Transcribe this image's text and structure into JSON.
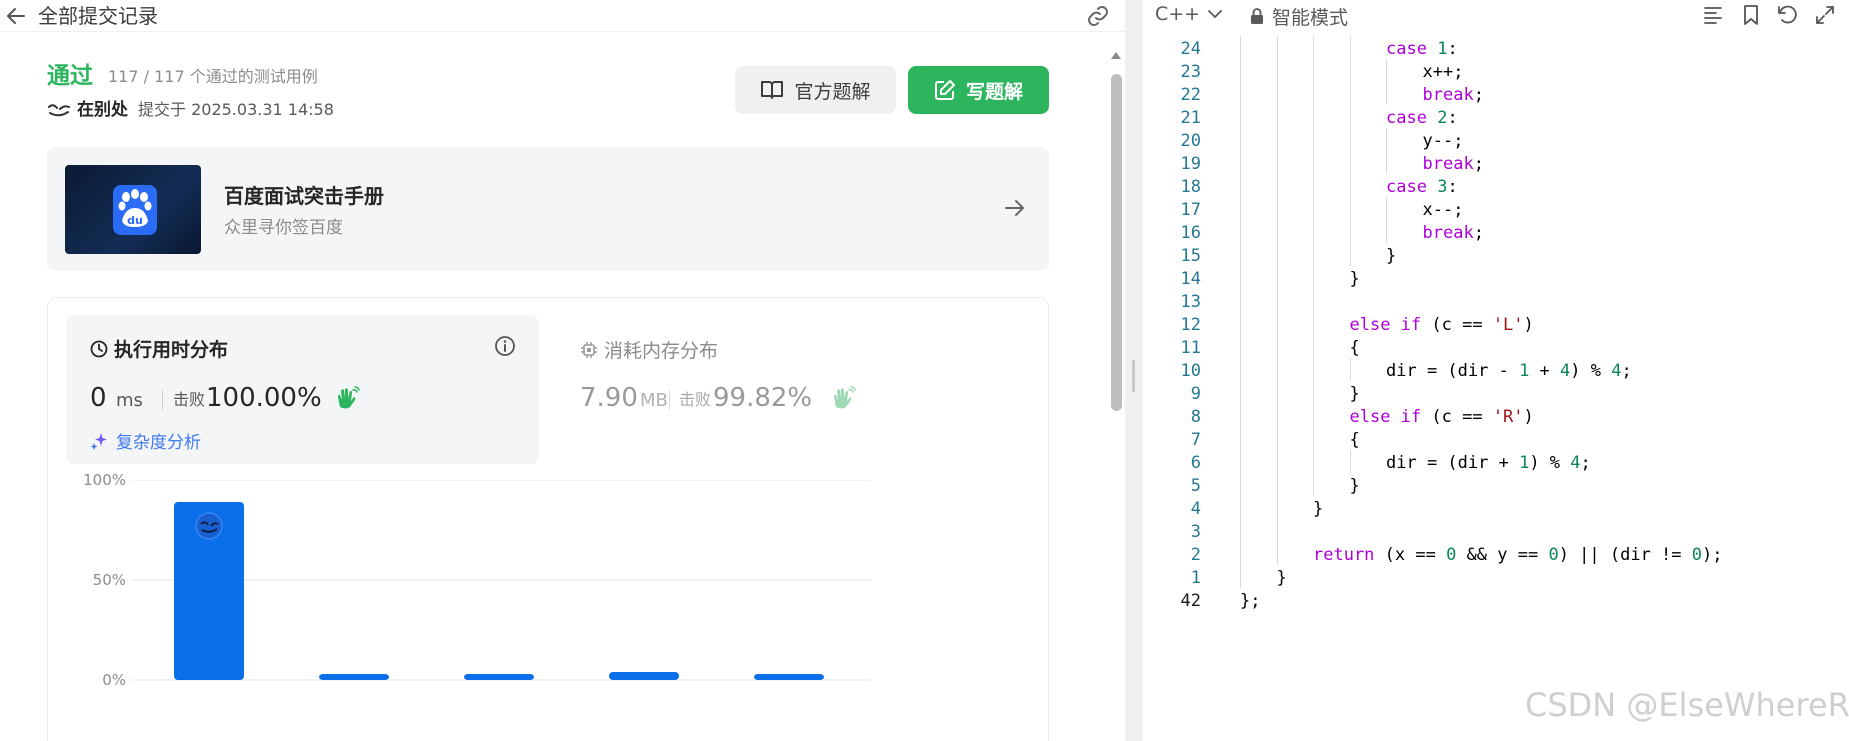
{
  "topbar": {
    "title": "全部提交记录",
    "back_icon": "arrow-left-icon",
    "link_icon": "link-icon"
  },
  "submission": {
    "status": "通过",
    "tests_detail": "117 / 117 个通过的测试用例",
    "author": "在别处",
    "submitted_at": "提交于 2025.03.31 14:58"
  },
  "buttons": {
    "official_solution": "官方题解",
    "write_solution": "写题解"
  },
  "promo": {
    "title": "百度面试突击手册",
    "subtitle": "众里寻你签百度",
    "logo_text": "du"
  },
  "runtime": {
    "title": "执行用时分布",
    "value": "0",
    "unit": "ms",
    "beat_label": "击败",
    "beat_value": "100.00%",
    "complexity_link": "复杂度分析"
  },
  "memory": {
    "title": "消耗内存分布",
    "value": "7.90",
    "unit": "MB",
    "beat_label": "击败",
    "beat_value": "99.82%"
  },
  "chart_data": {
    "type": "bar",
    "title": "",
    "xlabel": "",
    "ylabel": "",
    "y_ticks": [
      "100%",
      "50%",
      "0%"
    ],
    "ylim": [
      0,
      100
    ],
    "grid": true,
    "values": [
      89,
      3,
      3,
      4,
      3
    ],
    "highlight_index": 0,
    "bar_color": "#0a6fe8"
  },
  "editor": {
    "language": "C++",
    "mode": "智能模式",
    "lines": [
      {
        "n": "24",
        "code": [
          {
            "t": "case ",
            "c": "kw"
          },
          {
            "t": "1",
            "c": "num"
          },
          {
            "t": ":",
            "c": ""
          }
        ],
        "indent": 4
      },
      {
        "n": "23",
        "code": [
          {
            "t": "x++;",
            "c": ""
          }
        ],
        "indent": 5
      },
      {
        "n": "22",
        "code": [
          {
            "t": "break",
            "c": "kw"
          },
          {
            "t": ";",
            "c": ""
          }
        ],
        "indent": 5
      },
      {
        "n": "21",
        "code": [
          {
            "t": "case ",
            "c": "kw"
          },
          {
            "t": "2",
            "c": "num"
          },
          {
            "t": ":",
            "c": ""
          }
        ],
        "indent": 4
      },
      {
        "n": "20",
        "code": [
          {
            "t": "y--;",
            "c": ""
          }
        ],
        "indent": 5
      },
      {
        "n": "19",
        "code": [
          {
            "t": "break",
            "c": "kw"
          },
          {
            "t": ";",
            "c": ""
          }
        ],
        "indent": 5
      },
      {
        "n": "18",
        "code": [
          {
            "t": "case ",
            "c": "kw"
          },
          {
            "t": "3",
            "c": "num"
          },
          {
            "t": ":",
            "c": ""
          }
        ],
        "indent": 4
      },
      {
        "n": "17",
        "code": [
          {
            "t": "x--;",
            "c": ""
          }
        ],
        "indent": 5
      },
      {
        "n": "16",
        "code": [
          {
            "t": "break",
            "c": "kw"
          },
          {
            "t": ";",
            "c": ""
          }
        ],
        "indent": 5
      },
      {
        "n": "15",
        "code": [
          {
            "t": "}",
            "c": ""
          }
        ],
        "indent": 4
      },
      {
        "n": "14",
        "code": [
          {
            "t": "}",
            "c": ""
          }
        ],
        "indent": 3
      },
      {
        "n": "13",
        "code": [],
        "indent": 3
      },
      {
        "n": "12",
        "code": [
          {
            "t": "else if ",
            "c": "kw"
          },
          {
            "t": "(c == ",
            "c": ""
          },
          {
            "t": "'L'",
            "c": "str"
          },
          {
            "t": ")",
            "c": ""
          }
        ],
        "indent": 3
      },
      {
        "n": "11",
        "code": [
          {
            "t": "{",
            "c": ""
          }
        ],
        "indent": 3
      },
      {
        "n": "10",
        "code": [
          {
            "t": "dir = (dir - ",
            "c": ""
          },
          {
            "t": "1",
            "c": "num"
          },
          {
            "t": " + ",
            "c": ""
          },
          {
            "t": "4",
            "c": "num"
          },
          {
            "t": ") % ",
            "c": ""
          },
          {
            "t": "4",
            "c": "num"
          },
          {
            "t": ";",
            "c": ""
          }
        ],
        "indent": 4
      },
      {
        "n": "9",
        "code": [
          {
            "t": "}",
            "c": ""
          }
        ],
        "indent": 3
      },
      {
        "n": "8",
        "code": [
          {
            "t": "else if ",
            "c": "kw"
          },
          {
            "t": "(c == ",
            "c": ""
          },
          {
            "t": "'R'",
            "c": "str"
          },
          {
            "t": ")",
            "c": ""
          }
        ],
        "indent": 3
      },
      {
        "n": "7",
        "code": [
          {
            "t": "{",
            "c": ""
          }
        ],
        "indent": 3
      },
      {
        "n": "6",
        "code": [
          {
            "t": "dir = (dir + ",
            "c": ""
          },
          {
            "t": "1",
            "c": "num"
          },
          {
            "t": ") % ",
            "c": ""
          },
          {
            "t": "4",
            "c": "num"
          },
          {
            "t": ";",
            "c": ""
          }
        ],
        "indent": 4
      },
      {
        "n": "5",
        "code": [
          {
            "t": "}",
            "c": ""
          }
        ],
        "indent": 3
      },
      {
        "n": "4",
        "code": [
          {
            "t": "}",
            "c": ""
          }
        ],
        "indent": 2
      },
      {
        "n": "3",
        "code": [],
        "indent": 2
      },
      {
        "n": "2",
        "code": [
          {
            "t": "return ",
            "c": "kw"
          },
          {
            "t": "(x == ",
            "c": ""
          },
          {
            "t": "0",
            "c": "num"
          },
          {
            "t": " && y == ",
            "c": ""
          },
          {
            "t": "0",
            "c": "num"
          },
          {
            "t": ") || (dir != ",
            "c": ""
          },
          {
            "t": "0",
            "c": "num"
          },
          {
            "t": ");",
            "c": ""
          }
        ],
        "indent": 2
      },
      {
        "n": "1",
        "code": [
          {
            "t": "}",
            "c": ""
          }
        ],
        "indent": 1
      },
      {
        "n": "42",
        "code": [
          {
            "t": "};",
            "c": ""
          }
        ],
        "indent": 0,
        "current": true
      }
    ]
  },
  "watermark": "CSDN @ElseWhereR",
  "colors": {
    "accent_green": "#2db55d",
    "bar_blue": "#0a6fe8",
    "link_blue": "#3e7bf0"
  }
}
